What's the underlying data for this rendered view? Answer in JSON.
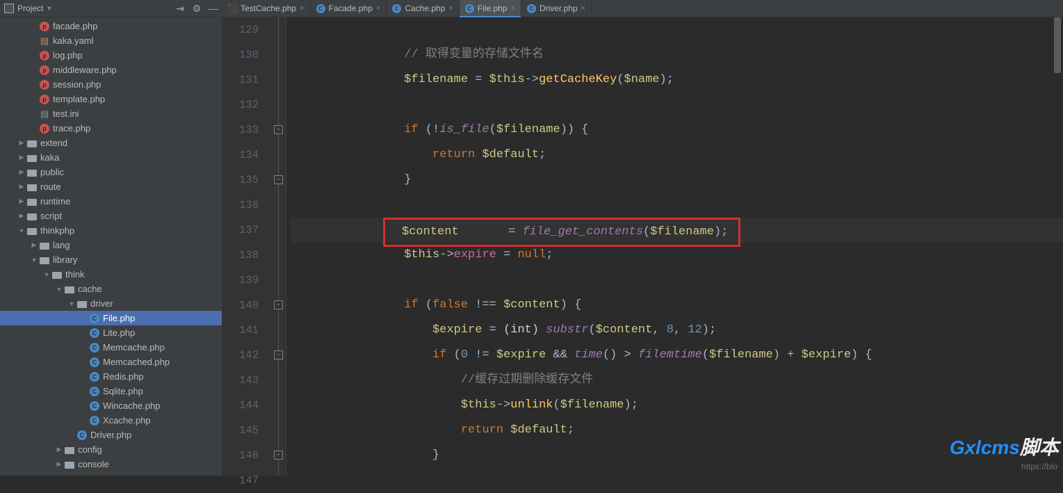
{
  "header": {
    "title": "Project"
  },
  "tree": [
    {
      "depth": 2,
      "arrow": "no",
      "icon": "php",
      "label": "facade.php"
    },
    {
      "depth": 2,
      "arrow": "no",
      "icon": "yml",
      "label": "kaka.yaml"
    },
    {
      "depth": 2,
      "arrow": "no",
      "icon": "php",
      "label": "log.php"
    },
    {
      "depth": 2,
      "arrow": "no",
      "icon": "php",
      "label": "middleware.php"
    },
    {
      "depth": 2,
      "arrow": "no",
      "icon": "php",
      "label": "session.php"
    },
    {
      "depth": 2,
      "arrow": "no",
      "icon": "php",
      "label": "template.php"
    },
    {
      "depth": 2,
      "arrow": "no",
      "icon": "ini",
      "label": "test.ini"
    },
    {
      "depth": 2,
      "arrow": "no",
      "icon": "php",
      "label": "trace.php"
    },
    {
      "depth": 1,
      "arrow": "right",
      "icon": "folder",
      "label": "extend"
    },
    {
      "depth": 1,
      "arrow": "right",
      "icon": "folder",
      "label": "kaka"
    },
    {
      "depth": 1,
      "arrow": "right",
      "icon": "folder",
      "label": "public"
    },
    {
      "depth": 1,
      "arrow": "right",
      "icon": "folder",
      "label": "route"
    },
    {
      "depth": 1,
      "arrow": "right",
      "icon": "folder",
      "label": "runtime"
    },
    {
      "depth": 1,
      "arrow": "right",
      "icon": "folder",
      "label": "script"
    },
    {
      "depth": 1,
      "arrow": "down",
      "icon": "folder",
      "label": "thinkphp"
    },
    {
      "depth": 2,
      "arrow": "right",
      "icon": "folder",
      "label": "lang"
    },
    {
      "depth": 2,
      "arrow": "down",
      "icon": "folder",
      "label": "library"
    },
    {
      "depth": 3,
      "arrow": "down",
      "icon": "folder",
      "label": "think"
    },
    {
      "depth": 4,
      "arrow": "down",
      "icon": "folder",
      "label": "cache"
    },
    {
      "depth": 5,
      "arrow": "down",
      "icon": "folder",
      "label": "driver"
    },
    {
      "depth": 6,
      "arrow": "no",
      "icon": "class",
      "label": "File.php",
      "sel": true
    },
    {
      "depth": 6,
      "arrow": "no",
      "icon": "class",
      "label": "Lite.php"
    },
    {
      "depth": 6,
      "arrow": "no",
      "icon": "class",
      "label": "Memcache.php"
    },
    {
      "depth": 6,
      "arrow": "no",
      "icon": "class",
      "label": "Memcached.php"
    },
    {
      "depth": 6,
      "arrow": "no",
      "icon": "class",
      "label": "Redis.php"
    },
    {
      "depth": 6,
      "arrow": "no",
      "icon": "class",
      "label": "Sqlite.php"
    },
    {
      "depth": 6,
      "arrow": "no",
      "icon": "class",
      "label": "Wincache.php"
    },
    {
      "depth": 6,
      "arrow": "no",
      "icon": "class",
      "label": "Xcache.php"
    },
    {
      "depth": 5,
      "arrow": "no",
      "icon": "class",
      "label": "Driver.php"
    },
    {
      "depth": 4,
      "arrow": "right",
      "icon": "folder",
      "label": "config"
    },
    {
      "depth": 4,
      "arrow": "right",
      "icon": "folder",
      "label": "console"
    }
  ],
  "tabs": [
    {
      "icon": "test",
      "label": "TestCache.php",
      "active": false
    },
    {
      "icon": "php",
      "label": "Facade.php",
      "active": false
    },
    {
      "icon": "php",
      "label": "Cache.php",
      "active": false
    },
    {
      "icon": "php",
      "label": "File.php",
      "active": true
    },
    {
      "icon": "php",
      "label": "Driver.php",
      "active": false
    }
  ],
  "gutter": [
    "129",
    "130",
    "131",
    "132",
    "133",
    "134",
    "135",
    "136",
    "137",
    "138",
    "139",
    "140",
    "141",
    "142",
    "143",
    "144",
    "145",
    "146",
    "147"
  ],
  "code": {
    "l130_comment": "// 取得变量的存储文件名",
    "l131": {
      "var1": "$filename",
      "eq": " = ",
      "this": "$this",
      "arr": "->",
      "fn": "getCacheKey",
      "open": "(",
      "arg": "$name",
      "close": ");"
    },
    "l133": {
      "if": "if ",
      "open": "(",
      "neg": "!",
      "fn": "is_file",
      "p1": "(",
      "arg": "$filename",
      "p2": ")) {"
    },
    "l134": {
      "ret": "return ",
      "var": "$default",
      "semi": ";"
    },
    "l135_brace": "}",
    "l137": {
      "var1": "$content",
      "pad": "       ",
      "eq": "= ",
      "fn": "file_get_contents",
      "open": "(",
      "arg": "$filename",
      "close": ");"
    },
    "l138": {
      "this": "$this",
      "arr": "->",
      "prop": "expire",
      "eq": " = ",
      "null": "null",
      "semi": ";"
    },
    "l140": {
      "if": "if ",
      "open": "(",
      "false": "false ",
      "neq": "!== ",
      "var": "$content",
      "close": ") {"
    },
    "l141": {
      "var": "$expire",
      "eq": " = ",
      "cast": "(int) ",
      "fn": "substr",
      "open": "(",
      "a1": "$content",
      "c": ", ",
      "n1": "8",
      "c2": ", ",
      "n2": "12",
      "close": ");"
    },
    "l142": {
      "if": "if ",
      "open": "(",
      "n0": "0 ",
      "neq": "!= ",
      "v1": "$expire ",
      "and": "&& ",
      "fn1": "time",
      "p1": "() ",
      "gt": "> ",
      "fn2": "filemtime",
      "p2": "(",
      "a2": "$filename",
      "p3": ") ",
      "plus": "+ ",
      "v2": "$expire",
      "close": ") {"
    },
    "l143_comment": "//缓存过期删除缓存文件",
    "l144": {
      "this": "$this",
      "arr": "->",
      "fn": "unlink",
      "open": "(",
      "arg": "$filename",
      "close": ");"
    },
    "l145": {
      "ret": "return ",
      "var": "$default",
      "semi": ";"
    },
    "l146_brace": "}"
  },
  "watermark": {
    "a": "Gxlcms",
    "b": "脚本",
    "url": "https://blo"
  }
}
